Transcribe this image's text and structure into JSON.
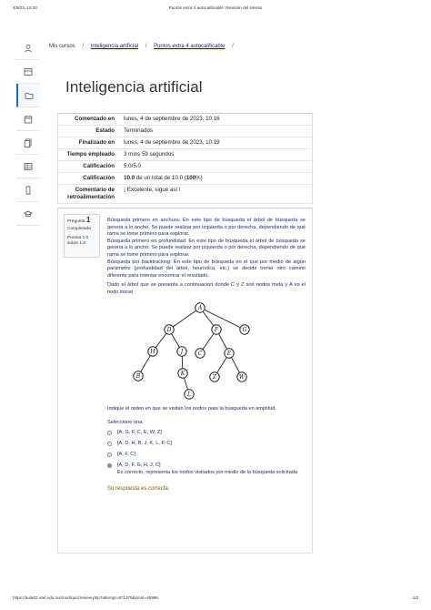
{
  "print": {
    "date": "4/9/23, 10:20",
    "title": "Puntos extra 4 autocalificable: Revisión del intento",
    "url": "https://aula02.utel.edu.mx/mod/quiz/review.php?attempt=871375&cmid=46996",
    "page": "1/2"
  },
  "breadcrumb": {
    "items": [
      "Mis cursos",
      "Inteligencia artificial",
      "Puntos extra 4 autocalificable"
    ],
    "separator": "/"
  },
  "page_title": "Inteligencia artificial",
  "summary": [
    {
      "key": "Comenzado en",
      "value": "lunes, 4 de septiembre de 2023, 10:16"
    },
    {
      "key": "Estado",
      "value": "Terminados"
    },
    {
      "key": "Finalizado en",
      "value": "lunes, 4 de septiembre de 2023, 10:19"
    },
    {
      "key": "Tiempo empleado",
      "value": "3 mins 59 segundos"
    },
    {
      "key": "Calificación",
      "value": "5.0/5.0"
    },
    {
      "key": "Calificación",
      "value_bold_1": "10.0",
      "value_mid": " de un total de 10.0 (",
      "value_bold_2": "100",
      "value_end": "%)"
    },
    {
      "key": "Comentario de retroalimentación",
      "value": "¡ Excelente, sigue así !"
    }
  ],
  "question": {
    "label": "Pregunta",
    "number": "1",
    "state": "Completada",
    "score": "Puntúa 1.0 sobre 1.0",
    "paragraphs": [
      "Búsqueda primero en anchura: En este tipo de búsqueda el árbol de búsqueda se genera a lo ancho. Se puede realizar por izquierda o por derecha, dependiendo de qué rama se tome primero para explorar.",
      "Búsqueda primero en profundidad: En este tipo de búsqueda el árbol de búsqueda se genera a lo ancho. Se puede realizar por izquierda o por derecha, dependiendo de qué rama se tome primero para explorar.",
      "Búsqueda por backtracking: En este tipo de búsqueda en el que por medio de algún parámetro (profundidad del árbol, heurística, etc.) se decide tomar otro camino diferente para intentar encontrar el resultado.",
      "Dado el árbol que se presenta a continuación donde C y Z son nodos meta y A es el nodo inicial"
    ],
    "prompt": "Indique el orden en que se visitan los nodos para la búsqueda en amplitud.",
    "select_label": "Seleccione una:",
    "options": [
      {
        "letter": "a.",
        "text": "[A, G, F, C, E, W, Z]",
        "checked": false
      },
      {
        "letter": "b.",
        "text": "[A, D, H, B, J, K, L, F, C]",
        "checked": false
      },
      {
        "letter": "c.",
        "text": "[A, F, C]",
        "checked": false
      },
      {
        "letter": "d.",
        "text": "[A, D, F, G, H, J, C]",
        "checked": true
      }
    ],
    "feedback": "Es correcto, representa los nodos visitados por medio de la búsqueda solicitada",
    "answer_status": "Su respuesta es correcta."
  },
  "tree_nodes": [
    {
      "id": "A",
      "label": "A"
    },
    {
      "id": "D",
      "label": "D"
    },
    {
      "id": "F",
      "label": "F"
    },
    {
      "id": "G",
      "label": "G"
    },
    {
      "id": "H",
      "label": "H"
    },
    {
      "id": "J",
      "label": "J"
    },
    {
      "id": "C",
      "label": "C"
    },
    {
      "id": "E",
      "label": "E"
    },
    {
      "id": "B",
      "label": "B"
    },
    {
      "id": "K",
      "label": "K"
    },
    {
      "id": "Z",
      "label": "Z"
    },
    {
      "id": "W",
      "label": "W"
    },
    {
      "id": "L",
      "label": "L"
    }
  ],
  "tree_edges": [
    [
      "A",
      "D"
    ],
    [
      "A",
      "F"
    ],
    [
      "A",
      "G"
    ],
    [
      "D",
      "H"
    ],
    [
      "D",
      "J"
    ],
    [
      "F",
      "C"
    ],
    [
      "F",
      "E"
    ],
    [
      "H",
      "B"
    ],
    [
      "J",
      "K"
    ],
    [
      "E",
      "Z"
    ],
    [
      "E",
      "W"
    ],
    [
      "K",
      "L"
    ]
  ],
  "rail_icons": [
    "graduation-cap-icon",
    "dashboard-icon",
    "folder-icon",
    "calendar-icon",
    "files-icon",
    "grid-icon",
    "mobile-icon",
    "graduation-hat-icon"
  ]
}
